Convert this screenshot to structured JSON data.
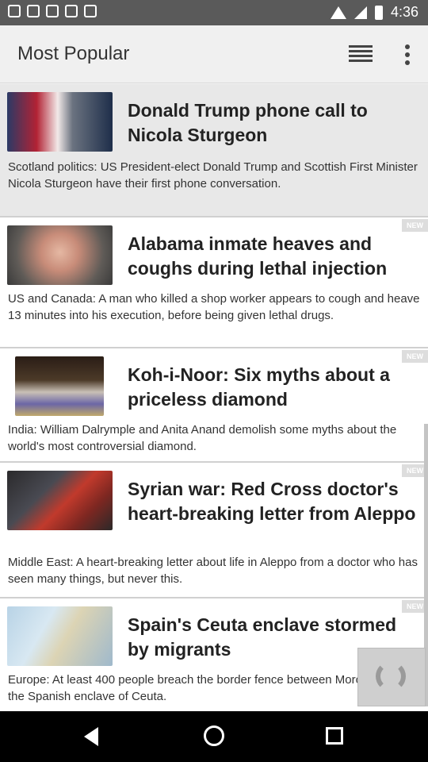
{
  "status_bar": {
    "time": "4:36"
  },
  "app_bar": {
    "title": "Most Popular",
    "menu_icon": "list-view-icon",
    "more_icon": "more-vert-icon"
  },
  "articles": [
    {
      "headline": "Donald Trump phone call to Nicola Sturgeon",
      "summary": "Scotland politics: US President-elect Donald Trump and Scottish First Minister Nicola Sturgeon have their first phone conversation.",
      "new": ""
    },
    {
      "headline": "Alabama inmate heaves and coughs during lethal injection",
      "summary": "US and Canada: A man who killed a shop worker appears to cough and heave 13 minutes into his execution, before being given lethal drugs.",
      "new": "NEW"
    },
    {
      "headline": "Koh-i-Noor: Six myths about a priceless diamond",
      "summary": "India: William Dalrymple and Anita Anand demolish some myths about the world's most controversial diamond.",
      "new": "NEW"
    },
    {
      "headline": "Syrian war: Red Cross doctor's heart-breaking letter from Aleppo",
      "summary": "Middle East: A heart-breaking letter about life in Aleppo from a doctor who has seen many things, but never this.",
      "new": "NEW"
    },
    {
      "headline": "Spain's Ceuta enclave stormed by migrants",
      "summary": "Europe: At least 400 people breach the border fence between Morocco and the Spanish enclave of Ceuta.",
      "new": "NEW"
    }
  ],
  "refresh_icon": "refresh-icon"
}
